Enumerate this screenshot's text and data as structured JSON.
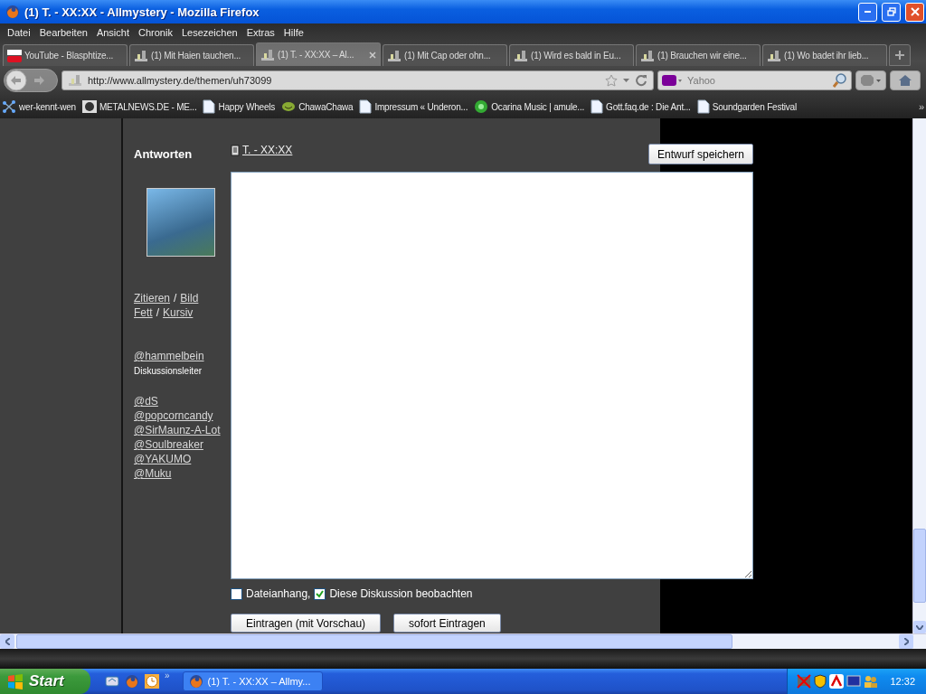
{
  "window": {
    "title": "(1) T. - XX:XX - Allmystery - Mozilla Firefox"
  },
  "menu": [
    "Datei",
    "Bearbeiten",
    "Ansicht",
    "Chronik",
    "Lesezeichen",
    "Extras",
    "Hilfe"
  ],
  "tabs": [
    {
      "label": "YouTube - Blasphtize...",
      "kind": "youtube",
      "selected": false
    },
    {
      "label": "(1) Mit Haien tauchen...",
      "kind": "site",
      "selected": false
    },
    {
      "label": "(1) T. - XX:XX – Al...",
      "kind": "site",
      "selected": true
    },
    {
      "label": "(1) Mit Cap oder ohn...",
      "kind": "site",
      "selected": false
    },
    {
      "label": "(1) Wird es bald in Eu...",
      "kind": "site",
      "selected": false
    },
    {
      "label": "(1) Brauchen wir eine...",
      "kind": "site",
      "selected": false
    },
    {
      "label": "(1) Wo badet ihr lieb...",
      "kind": "site",
      "selected": false
    }
  ],
  "address_bar": {
    "url": "http://www.allmystery.de/themen/uh73099"
  },
  "search_field": {
    "placeholder": "Yahoo"
  },
  "bookmarks": [
    {
      "label": "wer-kennt-wen",
      "kind": "network"
    },
    {
      "label": "METALNEWS.DE - ME...",
      "kind": "image"
    },
    {
      "label": "Happy Wheels",
      "kind": "page"
    },
    {
      "label": "ChawaChawa",
      "kind": "smiley"
    },
    {
      "label": "Impressum « Underon...",
      "kind": "page"
    },
    {
      "label": "Ocarina Music | amule...",
      "kind": "music"
    },
    {
      "label": "Gott.faq.de : Die Ant...",
      "kind": "page"
    },
    {
      "label": "Soundgarden Festival",
      "kind": "page"
    }
  ],
  "bookmarks_overflow": "»",
  "page": {
    "heading": "Antworten",
    "thread_link": "T. - XX:XX",
    "save_button": "Entwurf speichern",
    "format_rows": [
      {
        "links": [
          "Zitieren",
          "Bild"
        ],
        "separator": "/"
      },
      {
        "links": [
          "Fett",
          "Kursiv"
        ],
        "separator": "/"
      }
    ],
    "moderator": {
      "name": "@hammelbein",
      "role": "Diskussionsleiter"
    },
    "members": [
      "@dS",
      "@popcorncandy",
      "@SirMaunz-A-Lot",
      "@Soulbreaker",
      "@YAKUMO",
      "@Muku"
    ],
    "options": [
      {
        "label": "Dateianhang,",
        "checked": false
      },
      {
        "label": "Diese Diskussion beobachten",
        "checked": true
      }
    ],
    "buttons": [
      "Eintragen (mit Vorschau)",
      "sofort Eintragen"
    ]
  },
  "taskbar": {
    "start": "Start",
    "quick_launch_overflow": "»",
    "task": "(1) T. - XX:XX – Allmy...",
    "clock": "12:32"
  }
}
